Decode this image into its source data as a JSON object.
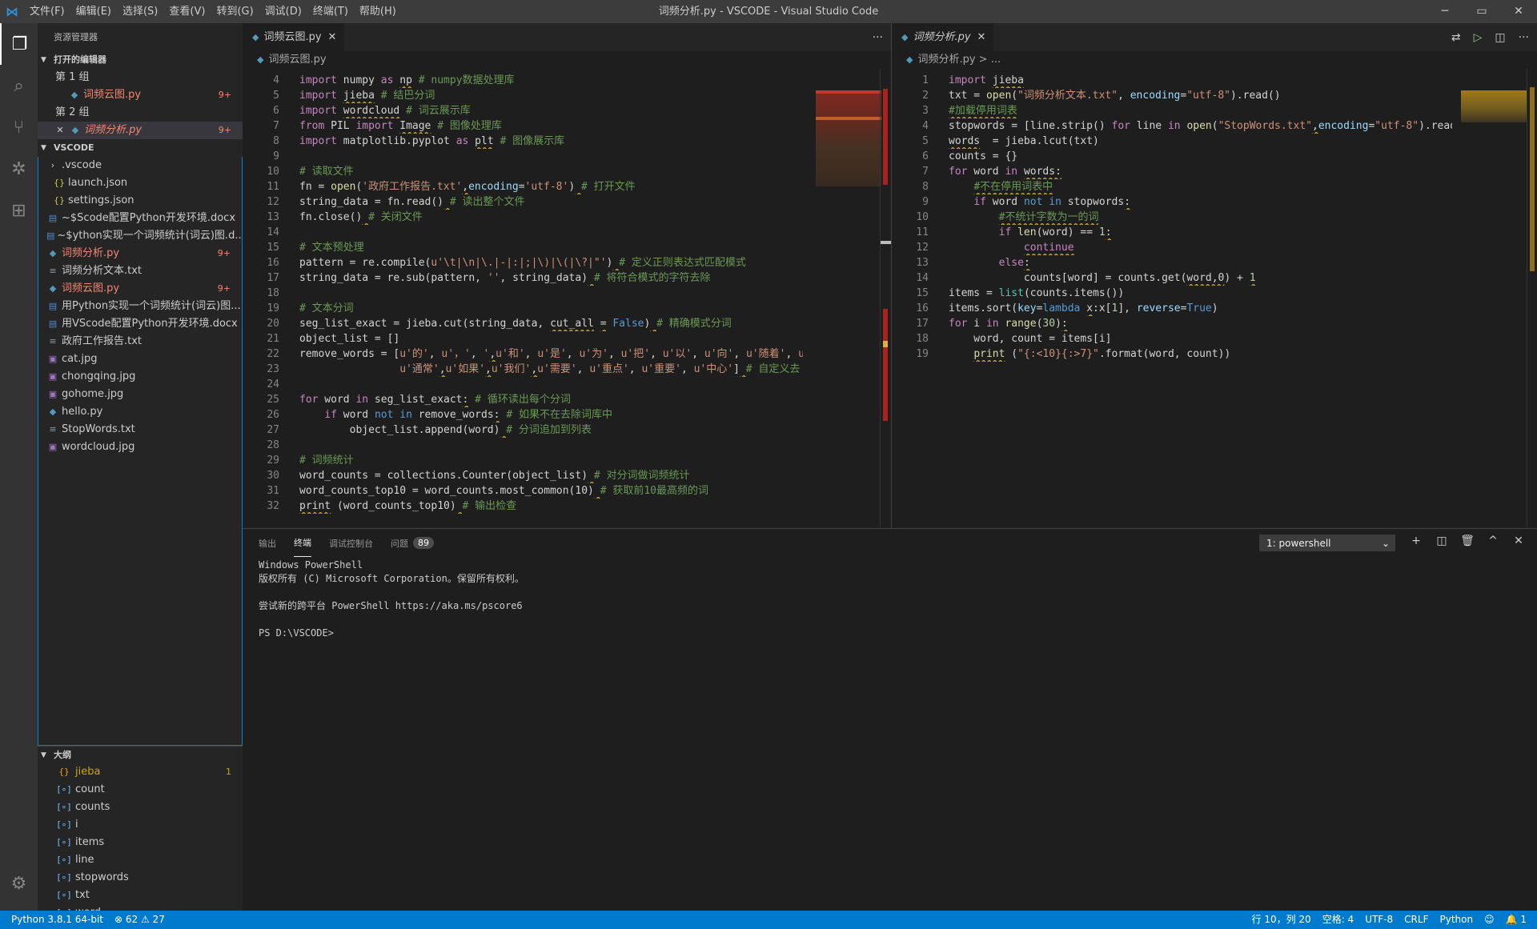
{
  "window": {
    "title": "词频分析.py - VSCODE - Visual Studio Code",
    "logo": "vscode-logo",
    "controls": [
      "─",
      "▭",
      "✕"
    ]
  },
  "menu": [
    "文件(F)",
    "编辑(E)",
    "选择(S)",
    "查看(V)",
    "转到(G)",
    "调试(D)",
    "终端(T)",
    "帮助(H)"
  ],
  "activity_icons": [
    "files-icon",
    "search-icon",
    "source-control-icon",
    "debug-icon",
    "extensions-icon",
    "settings-gear-icon"
  ],
  "sidebar": {
    "header": "资源管理器",
    "open_editors": {
      "title": "打开的编辑器",
      "group1": "第 1 组",
      "group1_file": "词频云图.py",
      "group1_badge": "9+",
      "group2": "第 2 组",
      "group2_file": "词频分析.py",
      "group2_badge": "9+"
    },
    "workspace": {
      "title": "VSCODE",
      "items": [
        {
          "name": ".vscode",
          "type": "folder",
          "indent": 1
        },
        {
          "name": "launch.json",
          "type": "json",
          "indent": 2
        },
        {
          "name": "settings.json",
          "type": "json",
          "indent": 2
        },
        {
          "name": "~$Scode配置Python开发环境.docx",
          "type": "doc",
          "indent": 1
        },
        {
          "name": "~$ython实现一个词频统计(词云)图.d...",
          "type": "doc",
          "indent": 1
        },
        {
          "name": "词频分析.py",
          "type": "py",
          "indent": 1,
          "badge": "9+",
          "error": true
        },
        {
          "name": "词频分析文本.txt",
          "type": "txt",
          "indent": 1
        },
        {
          "name": "词频云图.py",
          "type": "py",
          "indent": 1,
          "badge": "9+",
          "error": true
        },
        {
          "name": "用Python实现一个词频统计(词云)图...",
          "type": "doc",
          "indent": 1
        },
        {
          "name": "用VScode配置Python开发环境.docx",
          "type": "doc",
          "indent": 1
        },
        {
          "name": "政府工作报告.txt",
          "type": "txt",
          "indent": 1
        },
        {
          "name": "cat.jpg",
          "type": "img",
          "indent": 1
        },
        {
          "name": "chongqing.jpg",
          "type": "img",
          "indent": 1
        },
        {
          "name": "gohome.jpg",
          "type": "img",
          "indent": 1
        },
        {
          "name": "hello.py",
          "type": "py",
          "indent": 1
        },
        {
          "name": "StopWords.txt",
          "type": "txt",
          "indent": 1
        },
        {
          "name": "wordcloud.jpg",
          "type": "img",
          "indent": 1
        }
      ]
    },
    "outline": {
      "title": "大纲",
      "items": [
        {
          "name": "jieba",
          "kind": "module",
          "badge": "1"
        },
        {
          "name": "count",
          "kind": "var"
        },
        {
          "name": "counts",
          "kind": "var"
        },
        {
          "name": "i",
          "kind": "var"
        },
        {
          "name": "items",
          "kind": "var"
        },
        {
          "name": "line",
          "kind": "var"
        },
        {
          "name": "stopwords",
          "kind": "var"
        },
        {
          "name": "txt",
          "kind": "var"
        },
        {
          "name": "word",
          "kind": "var"
        }
      ]
    }
  },
  "editor_left": {
    "tab": "词频云图.py",
    "more": "···",
    "breadcrumb": "词频云图.py",
    "lines": [
      {
        "n": "4",
        "html": "<span class='kw'>import</span> numpy <span class='kw'>as</span> <span class='sq'>np</span> <span class='cmt'># numpy数据处理库</span>"
      },
      {
        "n": "5",
        "html": "<span class='kw'>import</span> <span class='sq'>jieba</span> <span class='cmt'># 结巴分词</span>"
      },
      {
        "n": "6",
        "html": "<span class='kw'>import</span> <span class='sq'>wordcloud</span> <span class='cmt'># 词云展示库</span>"
      },
      {
        "n": "7",
        "html": "<span class='kw'>from</span> PIL <span class='kw'>import</span> <span class='sq'>Image</span> <span class='cmt'># 图像处理库</span>"
      },
      {
        "n": "8",
        "html": "<span class='kw'>import</span> matplotlib.pyplot <span class='kw'>as</span> <span class='sq'>plt</span> <span class='cmt'># 图像展示库</span>"
      },
      {
        "n": "9",
        "html": ""
      },
      {
        "n": "10",
        "html": "<span class='cmt'># 读取文件</span>"
      },
      {
        "n": "11",
        "html": "fn = <span class='fn'>open</span>(<span class='str'>'政府工作报告.txt'</span><span class='sq'>,</span><span class='var'>encoding</span>=<span class='str'>'utf-8'</span>)<span class='sq'> </span><span class='cmt'># 打开文件</span>"
      },
      {
        "n": "12",
        "html": "string_data = fn.read()<span class='sq'> </span><span class='cmt'># 读出整个文件</span>"
      },
      {
        "n": "13",
        "html": "fn.close()<span class='sq'> </span><span class='cmt'># 关闭文件</span>"
      },
      {
        "n": "14",
        "html": ""
      },
      {
        "n": "15",
        "html": "<span class='cmt'># 文本预处理</span>"
      },
      {
        "n": "16",
        "html": "pattern = re.compile(<span class='str'>u'\\t|\\n|\\.|-|:|;|\\)|\\(|\\?|\"'</span>)<span class='sq'> </span><span class='cmt'># 定义正则表达式匹配模式</span>"
      },
      {
        "n": "17",
        "html": "string_data = re.sub(pattern, <span class='str'>''</span>, string_data)<span class='sq'> </span><span class='cmt'># 将符合模式的字符去除</span>"
      },
      {
        "n": "18",
        "html": ""
      },
      {
        "n": "19",
        "html": "<span class='cmt'># 文本分词</span>"
      },
      {
        "n": "20",
        "html": "seg_list_exact = jieba.cut(string_data, <span class='sq'>cut_all</span> <span class='sq'>=</span> <span class='kwb'>False</span>)<span class='sq'> </span><span class='cmt'># 精确模式分词</span>"
      },
      {
        "n": "21",
        "html": "object_list = []"
      },
      {
        "n": "22",
        "html": "remove_words = [<span class='str'>u'的'</span>, <span class='str'>u'，'</span>, <span class='str'>'</span><span class='sq'>,</span><span class='str'>u'和'</span>, <span class='str'>u'是'</span>, <span class='str'>u'为'</span>, <span class='str'>u'把'</span>, <span class='str'>u'以'</span>, <span class='str'>u'向'</span>, <span class='str'>u'随着'</span>, <span class='str'>u'对于'</span>"
      },
      {
        "n": "23",
        "html": "                <span class='str'>u'通常'</span><span class='sq'>,</span><span class='str'>u'如果'</span><span class='sq'>,</span><span class='str'>u'我们'</span><span class='sq'>,</span><span class='str'>u'需要'</span>, <span class='str'>u'重点'</span>, <span class='str'>u'重要'</span>, <span class='str'>u'中心'</span>]<span class='sq'> </span><span class='cmt'># 自定义去</span>"
      },
      {
        "n": "24",
        "html": ""
      },
      {
        "n": "25",
        "html": "<span class='kw'>for</span> word <span class='kw'>in</span> seg_list_exact<span class='sq'>:</span> <span class='cmt'># 循环读出每个分词</span>"
      },
      {
        "n": "26",
        "html": "    <span class='kw'>if</span> word <span class='kwb'>not</span> <span class='kwb'>in</span> remove_words<span class='sq'>:</span> <span class='cmt'># 如果不在去除词库中</span>"
      },
      {
        "n": "27",
        "html": "        object_list.append(word)<span class='sq'> </span><span class='cmt'># 分词追加到列表</span>"
      },
      {
        "n": "28",
        "html": ""
      },
      {
        "n": "29",
        "html": "<span class='cmt'># 词频统计</span>"
      },
      {
        "n": "30",
        "html": "word_counts = collections.Counter(object_list)<span class='sq'> </span><span class='cmt'># 对分词做词频统计</span>"
      },
      {
        "n": "31",
        "html": "word_counts_top10 = word_counts.most_common(10)<span class='sq'> </span><span class='cmt'># 获取前10最高频的词</span>"
      },
      {
        "n": "32",
        "html": "<span class='sq'>print</span> (word_counts_top10)<span class='sq'> </span><span class='cmt'># 输出检查</span>"
      }
    ]
  },
  "editor_right": {
    "tab": "词频分析.py",
    "breadcrumb": "词频分析.py > ...",
    "lines": [
      {
        "n": "1",
        "html": "<span class='kw'>import</span> <span class='sq'>jieba</span>"
      },
      {
        "n": "2",
        "html": "txt = <span class='fn'>open</span>(<span class='str'>\"词频分析文本.txt\"</span>, <span class='var'>encoding</span>=<span class='str'>\"utf-8\"</span>).read()"
      },
      {
        "n": "3",
        "html": "<span class='cmt sq'>#加载停用词表</span>"
      },
      {
        "n": "4",
        "html": "stopwords = [line.strip() <span class='kw'>for</span> line <span class='kw'>in</span> <span class='fn'>open</span>(<span class='str'>\"StopWords.txt\"</span><span class='sq'>,</span><span class='var'>encoding</span>=<span class='str'>\"utf-8\"</span>).readli"
      },
      {
        "n": "5",
        "html": "<span class='sq'>words</span>  = jieba.lcut(txt)"
      },
      {
        "n": "6",
        "html": "counts = {}"
      },
      {
        "n": "7",
        "html": "<span class='kw'>for</span> word <span class='kw'>in</span> <span class='sq'>words:</span>"
      },
      {
        "n": "8",
        "html": "    <span class='cmt sq'>#不在停用词表中</span>"
      },
      {
        "n": "9",
        "html": "    <span class='kw'>if</span> word <span class='kwb'>not</span> <span class='kwb'>in</span> stopwords<span class='sq'>:</span>"
      },
      {
        "n": "10",
        "html": "        <span class='cmt sq'>#不统计字数为一的词</span>"
      },
      {
        "n": "11",
        "html": "        <span class='kw'>if</span> <span class='fn'>len</span>(word) == <span class='num'>1</span><span class='sq'>:</span>"
      },
      {
        "n": "12",
        "html": "            <span class='kw sq'>continue</span>"
      },
      {
        "n": "13",
        "html": "        <span class='kw'>else</span><span class='sq'>:</span>"
      },
      {
        "n": "14",
        "html": "            counts[word] = counts.get(<span class='sq'>word,0</span>) + <span class='num sq'>1</span>"
      },
      {
        "n": "15",
        "html": "items = <span class='cls'>list</span>(counts.items())"
      },
      {
        "n": "16",
        "html": "items.sort(<span class='var'>key</span>=<span class='kwb'>lambda</span> <span class='sq'>x</span>:x[<span class='num'>1</span>], <span class='var'>reverse</span>=<span class='kwb'>True</span>)"
      },
      {
        "n": "17",
        "html": "<span class='kw'>for</span> i <span class='kw'>in</span> <span class='fn'>range</span>(<span class='num'>30</span>)<span class='sq'>:</span>"
      },
      {
        "n": "18",
        "html": "    word, count = items[i]"
      },
      {
        "n": "19",
        "html": "    <span class='fn sq'>print</span> (<span class='str'>\"{:&lt;10}{:&gt;7}\"</span>.format(word, count))"
      }
    ]
  },
  "panel": {
    "tabs": [
      "输出",
      "终端",
      "调试控制台",
      "问题"
    ],
    "problems_count": "89",
    "terminal_select": "1: powershell",
    "terminal_lines": [
      "Windows PowerShell",
      "版权所有 (C) Microsoft Corporation。保留所有权利。",
      "",
      "尝试新的跨平台 PowerShell https://aka.ms/pscore6",
      "",
      "PS D:\\VSCODE>"
    ],
    "actions": [
      "+",
      "◫",
      "🗑",
      "^",
      "✕"
    ]
  },
  "statusbar": {
    "python": "Python 3.8.1 64-bit",
    "errors": "⊗ 62",
    "warnings": "⚠ 27",
    "position": "行 10，列 20",
    "spaces": "空格: 4",
    "encoding": "UTF-8",
    "eol": "CRLF",
    "language": "Python",
    "notifications": "🔔 1"
  }
}
